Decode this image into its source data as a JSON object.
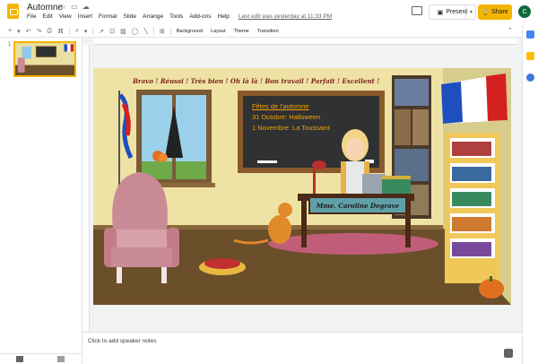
{
  "app": {
    "doc_title": "Automne",
    "menus": [
      "File",
      "Edit",
      "View",
      "Insert",
      "Format",
      "Slide",
      "Arrange",
      "Tools",
      "Add-ons",
      "Help"
    ],
    "last_edit": "Last edit was yesterday at 11:33 PM",
    "present_label": "Present",
    "share_label": "Share",
    "avatar_initial": "C"
  },
  "toolbar": {
    "background_label": "Background",
    "layout_label": "Layout",
    "theme_label": "Theme",
    "transition_label": "Transition"
  },
  "filmstrip": {
    "slide_number": "1"
  },
  "slide": {
    "praise_text": "Bravo !   Réussi !   Très bien !   Oh là là !   Bon travail !   Parfait !   Excellent !",
    "chalkboard_lines": [
      "Fêtes de l'automne",
      "31 Octobre: Halloween",
      "1 Novembre: La Toussaint"
    ],
    "nameplate": "Mme. Caroline Degrave"
  },
  "notes": {
    "placeholder": "Click to add speaker notes"
  },
  "colors": {
    "accent": "#f4b400",
    "wall": "#e8dfa0",
    "floor": "#6b4e2a",
    "chalk_text": "#f2a200"
  }
}
